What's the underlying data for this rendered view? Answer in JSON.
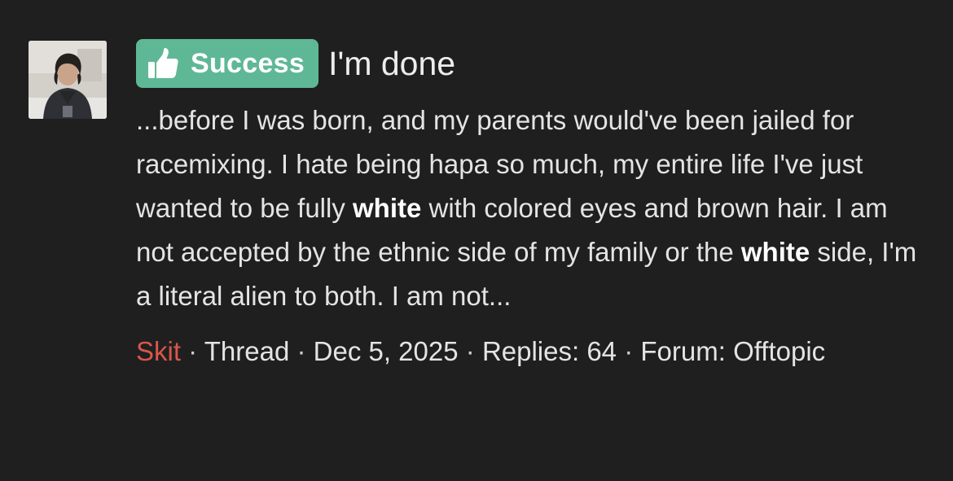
{
  "result": {
    "badge": {
      "label": "Success",
      "icon": "thumbs-up-icon",
      "color": "#5fb895"
    },
    "title": "I'm done",
    "snippet": {
      "seg1": "...before I was born, and my parents would've been jailed for racemixing. I hate being hapa so much, my entire life I've just wanted to be fully ",
      "highlight1": "white",
      "seg2": " with colored eyes and brown hair. I am not accepted by the ethnic side of my family or the ",
      "highlight2": "white",
      "seg3": " side, I'm a literal alien to both. I am not..."
    },
    "meta": {
      "author": "Skit",
      "author_color": "#d8574a",
      "separator": " · ",
      "type": "Thread",
      "date": "Dec 5, 2025",
      "replies": "Replies: 64",
      "forum_prefix": "Forum:",
      "forum": "Offtopic"
    }
  }
}
